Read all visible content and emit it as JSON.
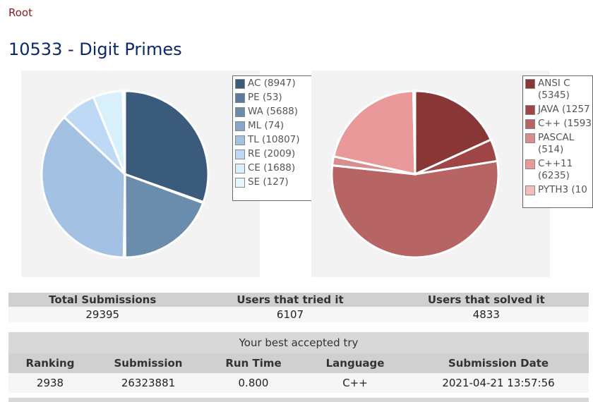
{
  "nav": {
    "root_label": "Root"
  },
  "problem": {
    "title": "10533 - Digit Primes"
  },
  "verdict_chart": {
    "type": "pie",
    "items": [
      {
        "label": "AC (8947)",
        "value": 8947,
        "color": "#3b5b7d"
      },
      {
        "label": "PE (53)",
        "value": 53,
        "color": "#5b7a9d"
      },
      {
        "label": "WA (5688)",
        "value": 5688,
        "color": "#6a8cad"
      },
      {
        "label": "ML (74)",
        "value": 74,
        "color": "#88a7c8"
      },
      {
        "label": "TL (10807)",
        "value": 10807,
        "color": "#a2c1e3"
      },
      {
        "label": "RE (2009)",
        "value": 2009,
        "color": "#bdd9f6"
      },
      {
        "label": "CE (1688)",
        "value": 1688,
        "color": "#d8f0fb"
      },
      {
        "label": "SE (127)",
        "value": 127,
        "color": "#e6f7fc"
      }
    ]
  },
  "language_chart": {
    "type": "pie",
    "items": [
      {
        "label": "ANSI C\n(5345)",
        "value": 5345,
        "color": "#883636"
      },
      {
        "label": "JAVA (1257",
        "value": 1257,
        "color": "#a04545"
      },
      {
        "label": "C++ (1593",
        "value": 15932,
        "color": "#b76464"
      },
      {
        "label": "PASCAL\n(514)",
        "value": 514,
        "color": "#d88e8e"
      },
      {
        "label": "C++11\n(6235)",
        "value": 6235,
        "color": "#e99999"
      },
      {
        "label": "PYTH3 (10",
        "value": 100,
        "color": "#f5bcbc"
      }
    ]
  },
  "stats": {
    "headers": [
      "Total Submissions",
      "Users that tried it",
      "Users that solved it"
    ],
    "values": [
      "29395",
      "6107",
      "4833"
    ]
  },
  "best_try": {
    "caption": "Your best accepted try",
    "headers": [
      "Ranking",
      "Submission",
      "Run Time",
      "Language",
      "Submission Date"
    ],
    "values": [
      "2938",
      "26323881",
      "0.800",
      "C++",
      "2021-04-21 13:57:56"
    ]
  }
}
